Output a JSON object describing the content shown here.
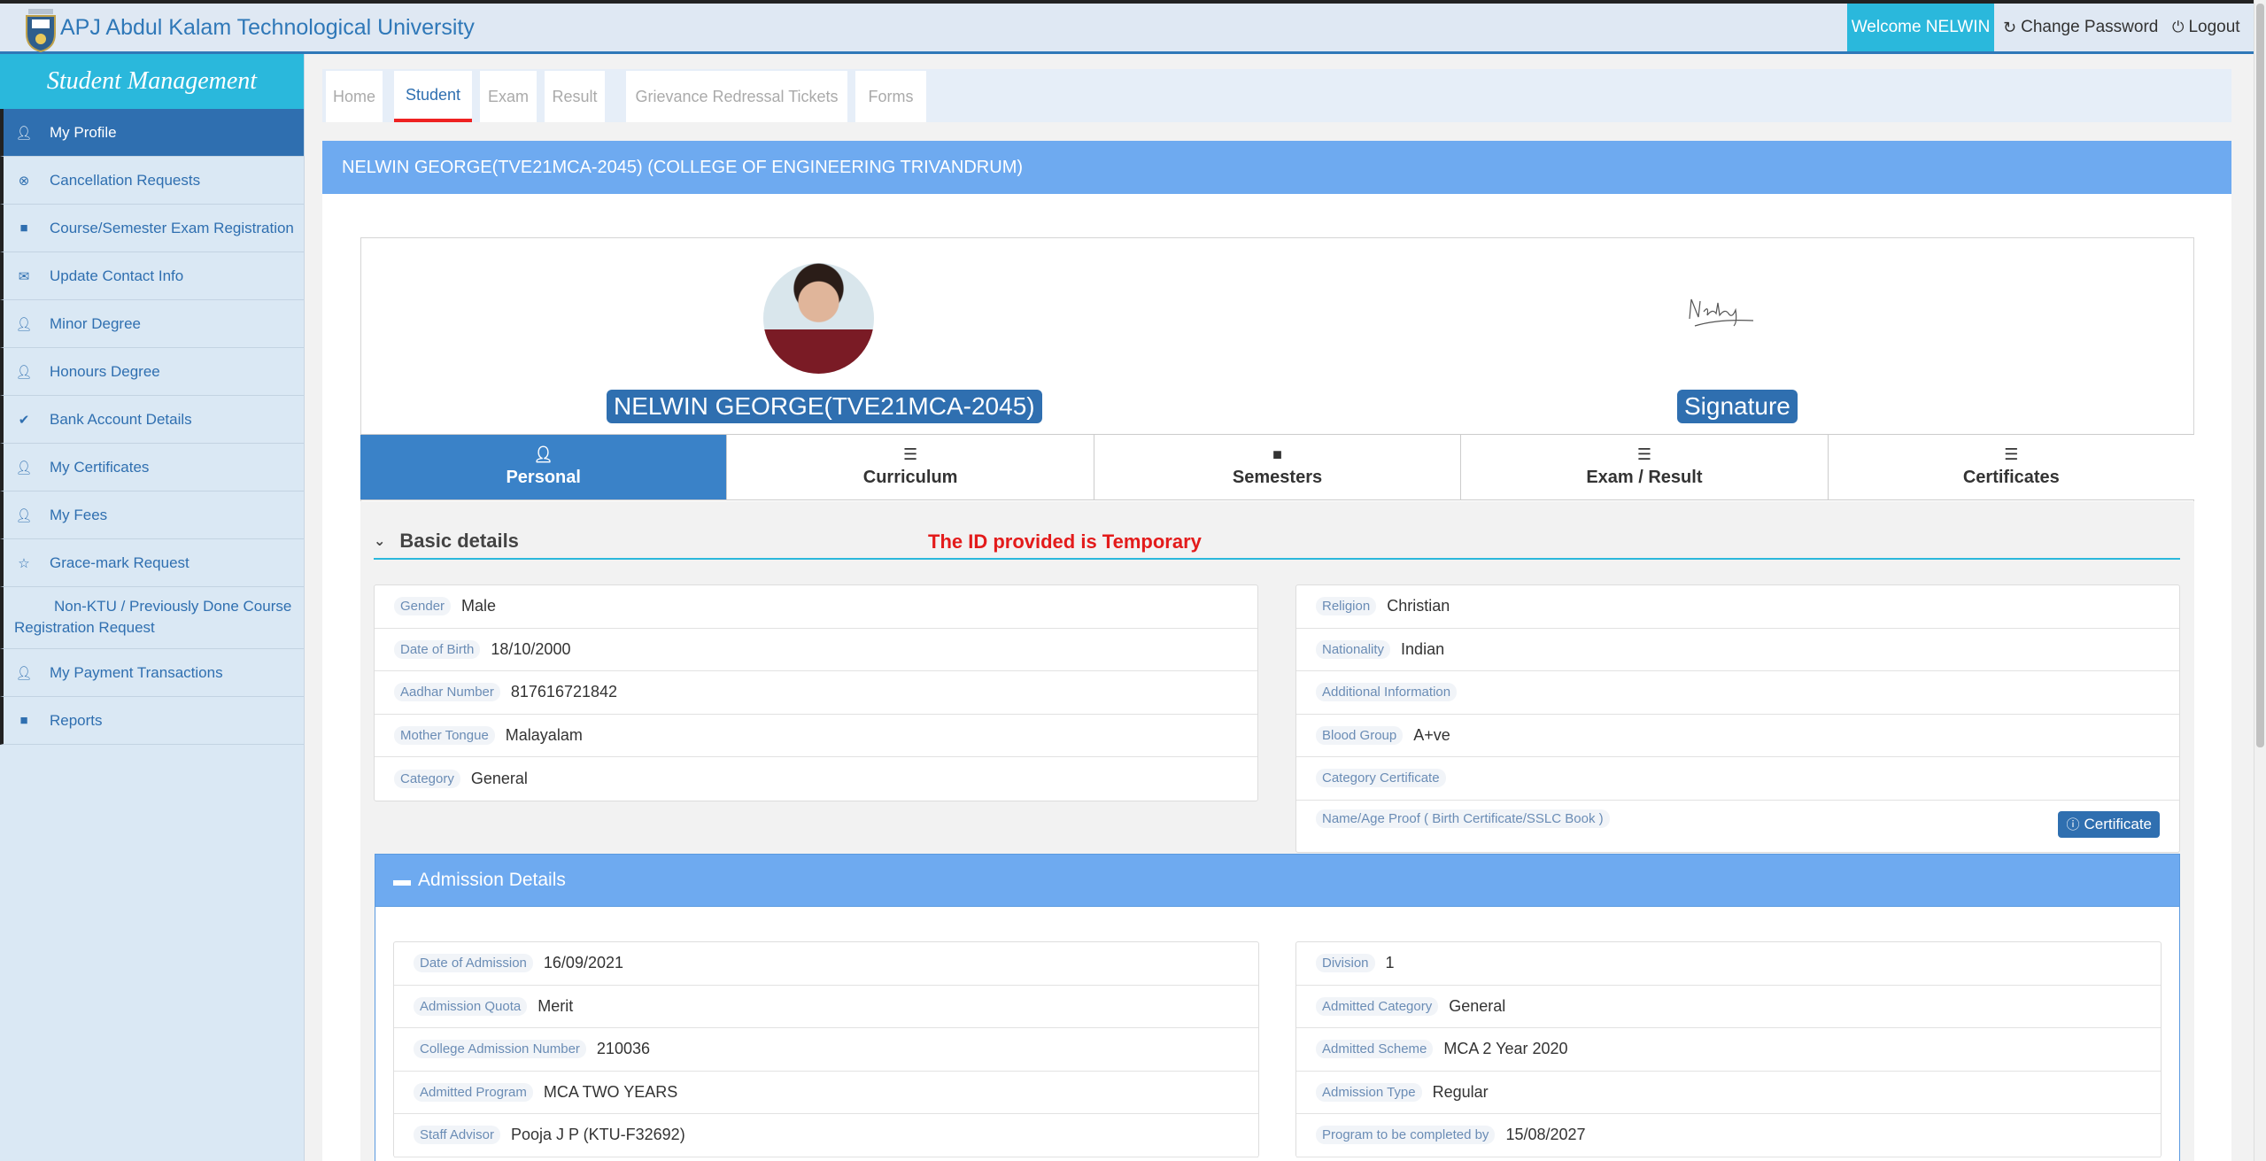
{
  "header": {
    "brand": "APJ Abdul Kalam Technological University",
    "welcome": "Welcome NELWIN",
    "change_password": "Change Password",
    "logout": "Logout"
  },
  "sidebar": {
    "title": "Student Management",
    "items": [
      {
        "label": "My Profile",
        "icon": "user-icon"
      },
      {
        "label": "Cancellation Requests",
        "icon": "cancel-icon"
      },
      {
        "label": "Course/Semester Exam Registration",
        "icon": "book-icon"
      },
      {
        "label": "Update Contact Info",
        "icon": "envelope-icon"
      },
      {
        "label": "Minor Degree",
        "icon": "user-icon"
      },
      {
        "label": "Honours Degree",
        "icon": "user-icon"
      },
      {
        "label": "Bank Account Details",
        "icon": "check-icon"
      },
      {
        "label": "My Certificates",
        "icon": "user-icon"
      },
      {
        "label": "My Fees",
        "icon": "user-icon"
      },
      {
        "label": "Grace-mark Request",
        "icon": "star-icon"
      },
      {
        "label": "Non-KTU / Previously Done Course Registration Request",
        "icon": ""
      },
      {
        "label": "My Payment Transactions",
        "icon": "user-icon"
      },
      {
        "label": "Reports",
        "icon": "book-icon"
      }
    ]
  },
  "tabs": [
    "Home",
    "Student",
    "Exam",
    "Result",
    "Grievance Redressal Tickets",
    "Forms"
  ],
  "panel": {
    "heading": "NELWIN GEORGE(TVE21MCA-2045) (COLLEGE OF ENGINEERING TRIVANDRUM)"
  },
  "profile": {
    "name_label": "NELWIN GEORGE(TVE21MCA-2045)",
    "signature_label": "Signature",
    "tabs": [
      {
        "label": "Personal",
        "icon": "user-icon"
      },
      {
        "label": "Curriculum",
        "icon": "list-icon"
      },
      {
        "label": "Semesters",
        "icon": "book-icon"
      },
      {
        "label": "Exam / Result",
        "icon": "list-icon"
      },
      {
        "label": "Certificates",
        "icon": "list-icon"
      }
    ]
  },
  "basic": {
    "title": "Basic details",
    "note": "The ID provided is Temporary",
    "left": [
      {
        "label": "Gender",
        "value": "Male"
      },
      {
        "label": "Date of Birth",
        "value": "18/10/2000"
      },
      {
        "label": "Aadhar Number",
        "value": "817616721842"
      },
      {
        "label": "Mother Tongue",
        "value": "Malayalam"
      },
      {
        "label": "Category",
        "value": "General"
      }
    ],
    "right": [
      {
        "label": "Religion",
        "value": "Christian"
      },
      {
        "label": "Nationality",
        "value": "Indian"
      },
      {
        "label": "Additional Information",
        "value": ""
      },
      {
        "label": "Blood Group",
        "value": "A+ve"
      },
      {
        "label": "Category Certificate",
        "value": ""
      },
      {
        "label": "Name/Age Proof ( Birth Certificate/SSLC Book )",
        "value": ""
      }
    ],
    "certificate_button": "Certificate"
  },
  "admission": {
    "title": "Admission Details",
    "left": [
      {
        "label": "Date of Admission",
        "value": "16/09/2021"
      },
      {
        "label": "Admission Quota",
        "value": "Merit"
      },
      {
        "label": "College Admission Number",
        "value": "210036"
      },
      {
        "label": "Admitted Program",
        "value": "MCA TWO YEARS"
      },
      {
        "label": "Staff Advisor",
        "value": "Pooja J P (KTU-F32692)"
      }
    ],
    "right": [
      {
        "label": "Division",
        "value": "1"
      },
      {
        "label": "Admitted Category",
        "value": "General"
      },
      {
        "label": "Admitted Scheme",
        "value": "MCA 2 Year 2020"
      },
      {
        "label": "Admission Type",
        "value": "Regular"
      },
      {
        "label": "Program to be completed by",
        "value": "15/08/2027"
      }
    ]
  }
}
